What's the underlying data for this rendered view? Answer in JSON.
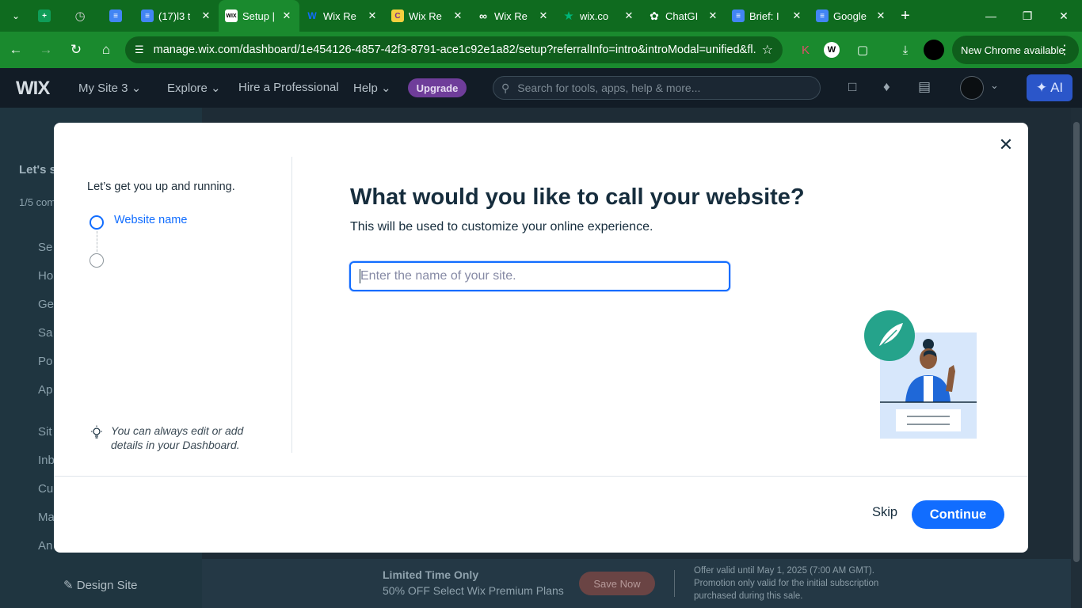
{
  "browser": {
    "tabs": [
      {
        "title": "",
        "icon": "sheets-icon",
        "color": "#0f9d58"
      },
      {
        "title": "",
        "icon": "globe-icon",
        "color": "#5f6368"
      },
      {
        "title": "",
        "icon": "docs-icon",
        "color": "#4285f4"
      },
      {
        "title": "(17)l3 t",
        "icon": "docs-icon",
        "color": "#4285f4"
      },
      {
        "title": "Setup |",
        "icon": "wix-icon",
        "color": "#ffffff",
        "active": true
      },
      {
        "title": "Wix Re",
        "icon": "wix-w-icon",
        "color": "#116dff"
      },
      {
        "title": "Wix Re",
        "icon": "c-icon",
        "color": "#f4d03f"
      },
      {
        "title": "Wix Re",
        "icon": "infinity-icon",
        "color": "#ffffff"
      },
      {
        "title": "wix.co",
        "icon": "star-icon",
        "color": "#00b67a"
      },
      {
        "title": "ChatGI",
        "icon": "chatgpt-icon",
        "color": "#ffffff"
      },
      {
        "title": "Brief: I",
        "icon": "docs-icon",
        "color": "#4285f4"
      },
      {
        "title": "Google",
        "icon": "docs-icon",
        "color": "#4285f4"
      }
    ],
    "url": "manage.wix.com/dashboard/1e454126-4857-42f3-8791-ace1c92e1a82/setup?referralInfo=intro&introModal=unified&fl...",
    "new_chrome": "New Chrome available"
  },
  "wix_header": {
    "logo": "WIX",
    "site_name": "My Site 3",
    "explore": "Explore",
    "hire": "Hire a Professional",
    "help": "Help",
    "upgrade": "Upgrade",
    "search_placeholder": "Search for tools, apps, help & more...",
    "ai": "AI"
  },
  "sidebar": {
    "title": "Let's se",
    "count": "1/5 com",
    "items": [
      "Se",
      "Ho",
      "Ge",
      "Sa",
      "Po",
      "Ap",
      "Sit",
      "Inb",
      "Cu",
      "Ma",
      "An"
    ],
    "design_site": "Design Site"
  },
  "promo": {
    "line1": "Limited Time Only",
    "line2": "50% OFF Select Wix Premium Plans",
    "button": "Save Now",
    "offer": "Offer valid until May 1, 2025 (7:00 AM GMT). Promotion only valid for the initial subscription purchased during this sale."
  },
  "modal": {
    "intro": "Let’s get you up and running.",
    "steps": [
      "Website name"
    ],
    "tip": "You can always edit or add details in your Dashboard.",
    "heading": "What would you like to call your website?",
    "subheading": "This will be used to customize your online experience.",
    "input_placeholder": "Enter the name of your site.",
    "input_value": "",
    "skip": "Skip",
    "continue": "Continue"
  },
  "colors": {
    "accent": "#116dff",
    "chrome_green": "#1a8a2e",
    "header_bg": "#121c26",
    "upgrade": "#6f3d9a"
  }
}
